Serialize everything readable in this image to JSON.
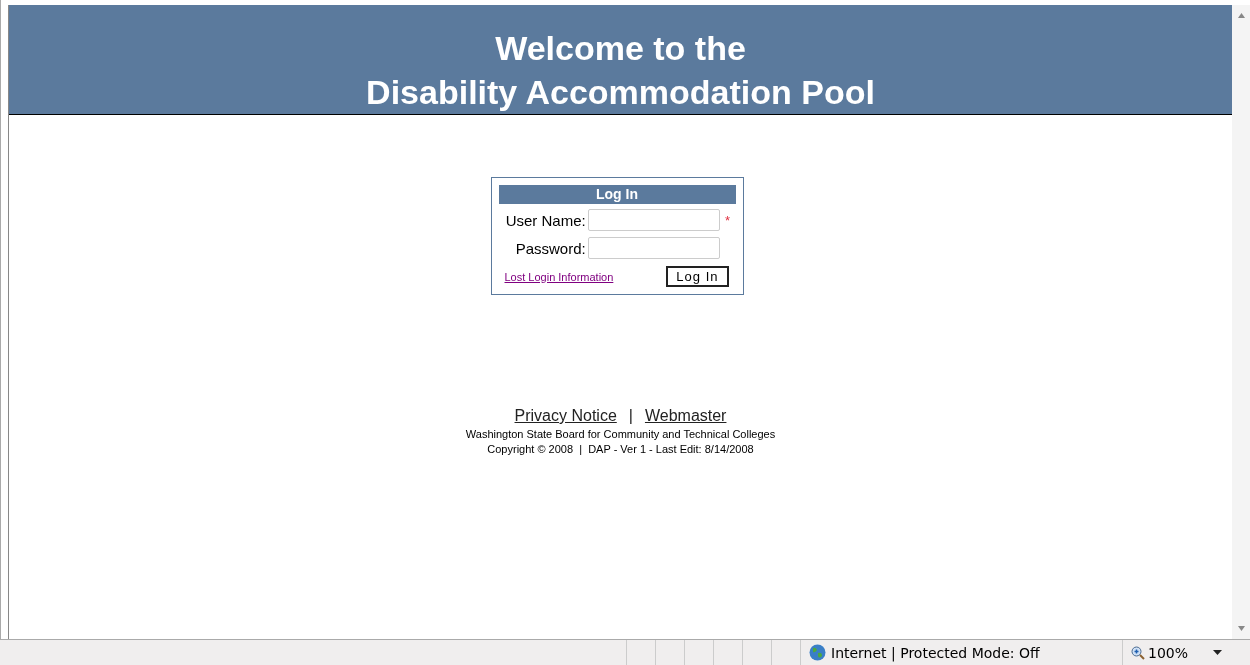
{
  "header": {
    "title_lines": [
      "Welcome to the",
      "Disability Accommodation Pool"
    ]
  },
  "login": {
    "title": "Log In",
    "required_mark": "*",
    "fields": [
      {
        "label": "User Name:",
        "required": true
      },
      {
        "label": "Password:",
        "required": false
      }
    ],
    "lost_link": "Lost Login Information",
    "submit": "Log In"
  },
  "footer": {
    "links": [
      "Privacy Notice",
      "Webmaster"
    ],
    "separator": "|",
    "org": "Washington State Board for Community and Technical Colleges",
    "copyright": "Copyright © 2008  |  DAP - Ver 1 - Last Edit: 8/14/2008"
  },
  "status_bar": {
    "zone": "Internet | Protected Mode: Off",
    "zoom": "100%"
  }
}
